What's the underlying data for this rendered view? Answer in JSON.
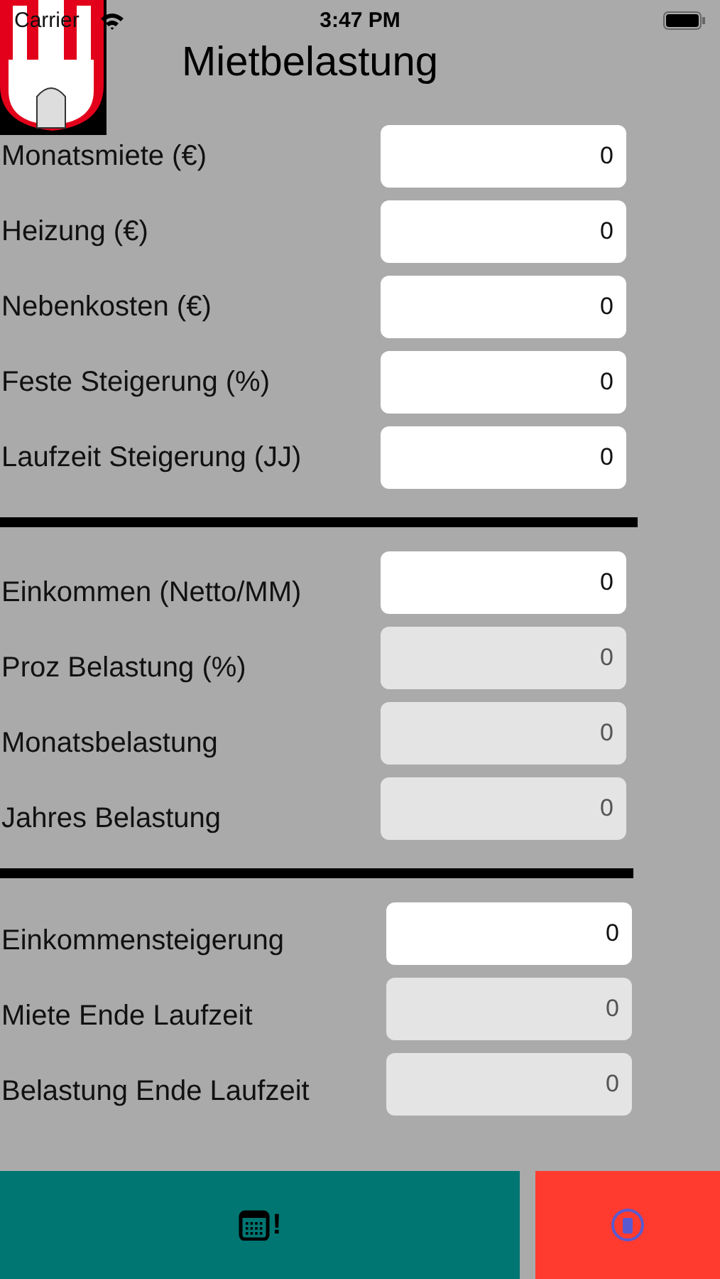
{
  "status_bar": {
    "carrier": "Carrier",
    "time": "3:47 PM"
  },
  "title": "Mietbelastung",
  "sections": [
    {
      "rows": [
        {
          "label": "Monatsmiete (€)",
          "value": "0",
          "disabled": false
        },
        {
          "label": "Heizung (€)",
          "value": "0",
          "disabled": false
        },
        {
          "label": "Nebenkosten (€)",
          "value": "0",
          "disabled": false
        },
        {
          "label": "Feste Steigerung (%)",
          "value": "0",
          "disabled": false
        },
        {
          "label": "Laufzeit Steigerung (JJ)",
          "value": "0",
          "disabled": false
        }
      ]
    },
    {
      "rows": [
        {
          "label": "Einkommen (Netto/MM)",
          "value": "0",
          "disabled": false
        },
        {
          "label": "Proz Belastung (%)",
          "value": "0",
          "disabled": true
        },
        {
          "label": "Monatsbelastung",
          "value": "0",
          "disabled": true
        },
        {
          "label": "Jahres Belastung",
          "value": "0",
          "disabled": true
        }
      ]
    },
    {
      "rows": [
        {
          "label": "Einkommensteigerung",
          "value": "0",
          "disabled": false
        },
        {
          "label": "Miete Ende Laufzeit",
          "value": "0",
          "disabled": true
        },
        {
          "label": "Belastung Ende Laufzeit",
          "value": "0",
          "disabled": true
        }
      ]
    }
  ],
  "buttons": [
    {
      "kind": "calendar",
      "text": "!"
    },
    {
      "kind": "delete"
    }
  ]
}
